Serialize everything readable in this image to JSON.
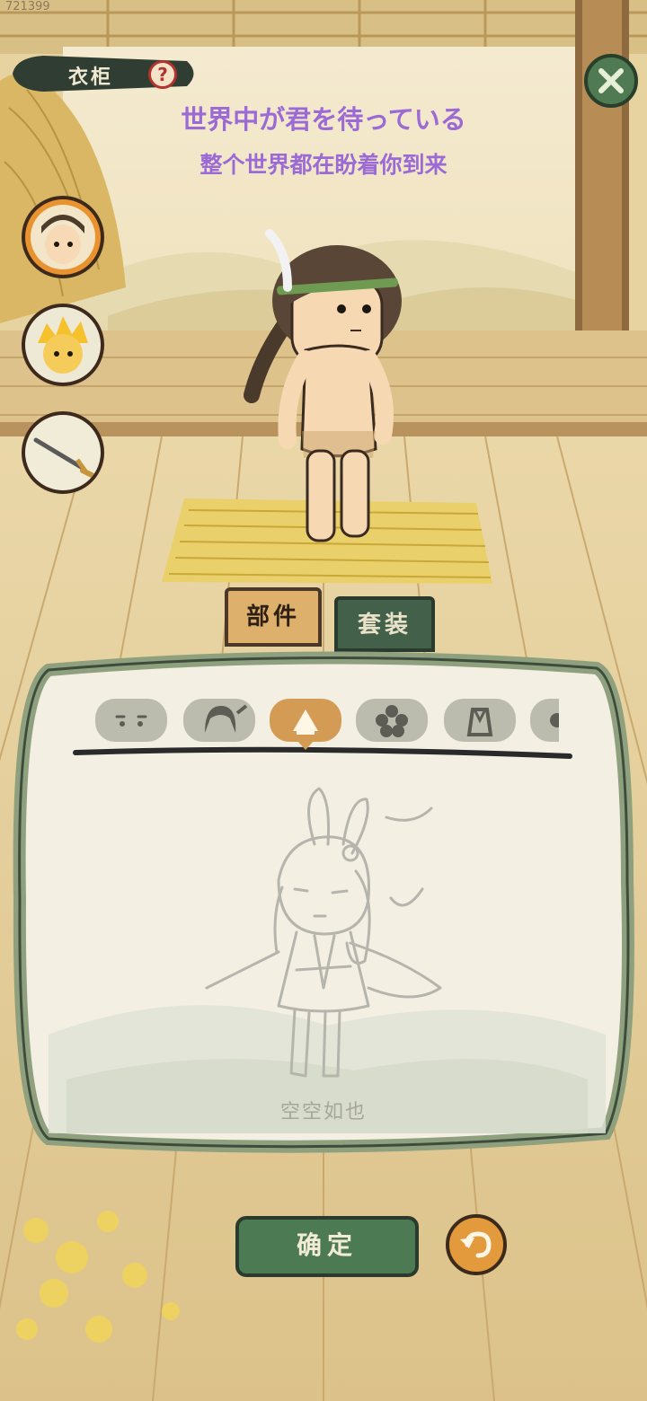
{
  "build_id": "721399",
  "header": {
    "title": "衣柜",
    "help_glyph": "?"
  },
  "captions": {
    "japanese": "世界中が君を待っている",
    "chinese": "整个世界都在盼着你到来"
  },
  "side_slots": [
    {
      "name": "hero-portrait",
      "active": true
    },
    {
      "name": "companion-portrait",
      "active": false
    },
    {
      "name": "weapon-sword",
      "active": false
    }
  ],
  "tabs": [
    {
      "label": "部件",
      "selected": true
    },
    {
      "label": "套装",
      "selected": false
    }
  ],
  "categories": [
    {
      "icon": "face-icon",
      "selected": false
    },
    {
      "icon": "hair-icon",
      "selected": false
    },
    {
      "icon": "clothes-icon",
      "selected": true
    },
    {
      "icon": "flower-ornament-icon",
      "selected": false
    },
    {
      "icon": "robe-icon",
      "selected": false
    },
    {
      "icon": "more-icon",
      "selected": false
    }
  ],
  "empty_state": {
    "label": "空空如也"
  },
  "actions": {
    "confirm_label": "确定",
    "undo_icon": "undo-icon"
  },
  "colors": {
    "accent_green": "#4c7a53",
    "accent_orange": "#d49b55",
    "caption_purple": "#9b6ad4",
    "help_red": "#b1322e"
  }
}
